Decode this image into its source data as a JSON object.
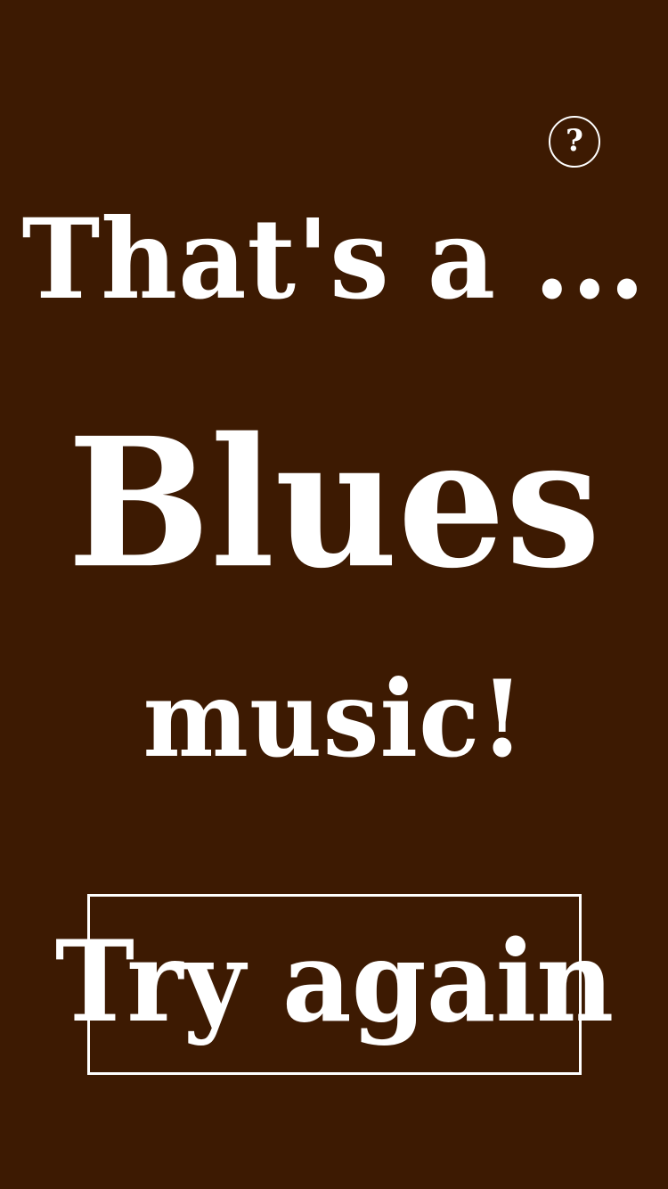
{
  "theme": {
    "background": "#3d1a02",
    "foreground": "#ffffff"
  },
  "header": {
    "help_icon": "question-mark-icon",
    "help_label": "?"
  },
  "result": {
    "intro": "That's a ...",
    "genre": "Blues",
    "outro": "music!"
  },
  "actions": {
    "try_again_label": "Try again"
  }
}
